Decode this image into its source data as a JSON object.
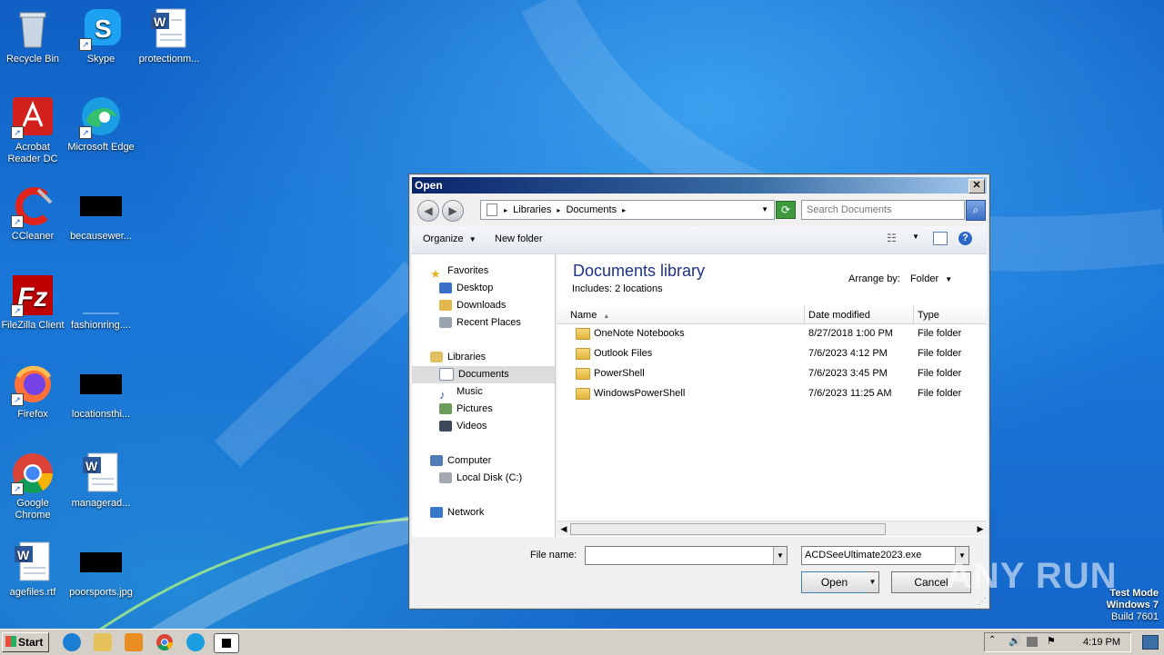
{
  "desktop": {
    "icons": [
      {
        "label": "Recycle Bin",
        "icon": "recycle-bin-icon"
      },
      {
        "label": "Skype",
        "icon": "skype-icon"
      },
      {
        "label": "protectionm...",
        "icon": "word-doc-icon"
      },
      {
        "label": "Acrobat Reader DC",
        "icon": "acrobat-icon"
      },
      {
        "label": "Microsoft Edge",
        "icon": "edge-icon"
      },
      {
        "label": "CCleaner",
        "icon": "ccleaner-icon"
      },
      {
        "label": "becausewer...",
        "icon": "redacted-thumbnail"
      },
      {
        "label": "FileZilla Client",
        "icon": "filezilla-icon"
      },
      {
        "label": "fashionring....",
        "icon": "blank-file-icon"
      },
      {
        "label": "Firefox",
        "icon": "firefox-icon"
      },
      {
        "label": "locationsthi...",
        "icon": "redacted-thumbnail"
      },
      {
        "label": "Google Chrome",
        "icon": "chrome-icon"
      },
      {
        "label": "managerad...",
        "icon": "word-doc-icon"
      },
      {
        "label": "agefiles.rtf",
        "icon": "word-doc-icon"
      },
      {
        "label": "poorsports.jpg",
        "icon": "redacted-thumbnail"
      }
    ]
  },
  "dialog": {
    "title": "Open",
    "close_label": "✕",
    "address": {
      "crumb1": "Libraries",
      "crumb2": "Documents"
    },
    "search_placeholder": "Search Documents",
    "toolbar": {
      "organize": "Organize",
      "new_folder": "New folder"
    },
    "nav": {
      "favorites": "Favorites",
      "desktop": "Desktop",
      "downloads": "Downloads",
      "recent": "Recent Places",
      "libraries": "Libraries",
      "documents": "Documents",
      "music": "Music",
      "pictures": "Pictures",
      "videos": "Videos",
      "computer": "Computer",
      "local_disk": "Local Disk (C:)",
      "network": "Network"
    },
    "library": {
      "title": "Documents library",
      "includes": "Includes:  2 locations",
      "arrange_by_label": "Arrange by:",
      "arrange_by_value": "Folder"
    },
    "columns": {
      "name": "Name",
      "date": "Date modified",
      "type": "Type"
    },
    "files": [
      {
        "name": "OneNote Notebooks",
        "date": "8/27/2018 1:00 PM",
        "type": "File folder"
      },
      {
        "name": "Outlook Files",
        "date": "7/6/2023 4:12 PM",
        "type": "File folder"
      },
      {
        "name": "PowerShell",
        "date": "7/6/2023 3:45 PM",
        "type": "File folder"
      },
      {
        "name": "WindowsPowerShell",
        "date": "7/6/2023 11:25 AM",
        "type": "File folder"
      }
    ],
    "file_name_label": "File name:",
    "file_name_value": "",
    "filter_value": "ACDSeeUltimate2023.exe",
    "open_label": "Open",
    "cancel_label": "Cancel"
  },
  "watermark": {
    "brand": "ANY RUN",
    "test_mode": "Test Mode",
    "os": "Windows 7",
    "build": "Build 7601"
  },
  "taskbar": {
    "start_label": "Start",
    "apps": [
      "ie-icon",
      "explorer-icon",
      "media-player-icon",
      "chrome-icon",
      "edge-icon",
      "acdsee-installer-icon"
    ],
    "clock": "4:19 PM"
  }
}
